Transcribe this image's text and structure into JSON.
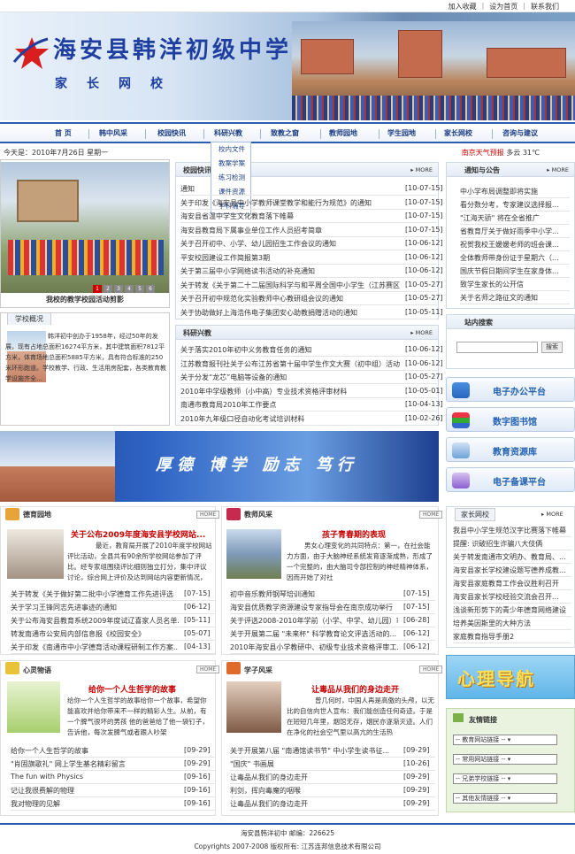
{
  "toplinks": [
    "加入收藏",
    "设为首页",
    "联系我们"
  ],
  "banner": {
    "school_name": "海安县韩洋初级中学",
    "subtitle": "家长网校"
  },
  "nav": [
    "首 页",
    "韩中风采",
    "校园快讯",
    "科研兴教",
    "致教之窗",
    "教师园地",
    "学生园地",
    "家长网校",
    "咨询与建议"
  ],
  "today": "今天是：2010年7月26日 星期一",
  "weather": {
    "label": "南京天气预报",
    "value": "多云 31℃"
  },
  "dropdown": [
    "校内文件",
    "教案学案",
    "练习检测",
    "课件资源",
    "学科辅导"
  ],
  "photo_caption": "我校的教学校园活动剪影",
  "slide_numbers": [
    "1",
    "2",
    "3",
    "4",
    "5",
    "6"
  ],
  "school_news": {
    "title": "校园快讯",
    "more": "MORE",
    "items": [
      {
        "text": "通知",
        "date": "[10-07-15]"
      },
      {
        "text": "关于印发《海安县中小学教师课堂教学和能行为规范》的通知",
        "date": "[10-07-15]"
      },
      {
        "text": "海安县省温中学生文化教育落下帷幕",
        "date": "[10-07-15]"
      },
      {
        "text": "海安县教育局下属事业单位工作人员招考简章",
        "date": "[10-07-15]"
      },
      {
        "text": "关于召开初中、小学、幼儿园招生工作会议的通知",
        "date": "[10-06-12]"
      },
      {
        "text": "平安校园建设工作简报第3期",
        "date": "[10-06-12]"
      },
      {
        "text": "关于第三届中小学网络读书活动的补充通知",
        "date": "[10-06-12]"
      },
      {
        "text": "关于转发《关于第二十二届国际科学与和平周全国中小学生（江苏赛区",
        "date": "[10-05-27]"
      },
      {
        "text": "关于召开初中规范化实验教师中心教研组会议的通知",
        "date": "[10-05-27]"
      },
      {
        "text": "关于协助做好上海浩伟电子集团安心助教捐赠活动的通知",
        "date": "[10-05-11]"
      }
    ]
  },
  "research": {
    "title": "科研兴教",
    "more": "MORE",
    "items": [
      {
        "text": "关于落实2010年初中义务教育任务的通知",
        "date": "[10-06-12]"
      },
      {
        "text": "江苏教育报刊社关于公布江苏省第十届中学生作文大赛（初中组）活动",
        "date": "[10-06-12]"
      },
      {
        "text": "关于分发“龙芯”电脑等设备的通知",
        "date": "[10-05-27]"
      },
      {
        "text": "2010年中学级教师（小中高）专业技术资格评审材料",
        "date": "[10-05-01]"
      },
      {
        "text": "南通市教育局2010年工作要点",
        "date": "[10-04-13]"
      },
      {
        "text": "2010年九年级口径自动化考试培训材料",
        "date": "[10-02-26]"
      }
    ]
  },
  "notices": {
    "title": "通知与公告",
    "more": "MORE",
    "items": [
      "中小学布局调整即将实施",
      "看分数分考，专家建议选择报...",
      "\"江海天骄\" 将在全省推广",
      "省教育厅关于做好雨季中小学...",
      "祝贺我校王媛媛老师的班会课...",
      "全体教师带身份证于星期六（...",
      "国庆节假日期间学生在家身体...",
      "致学生家长的公开信",
      "关于名师之路征文的通知"
    ]
  },
  "search": {
    "title": "站内搜索",
    "button": "搜索"
  },
  "school_intro": {
    "tab": "学校概况",
    "text": "韩洋初中创办于1958年，经过50年的发展，现有占地总面积16274平方米，其中建筑面积7812平方米，体育场地总面积5885平方米，具有符合标准的250米环形跑道。学校教学、行政、生活用房配套，各类教育教学设施齐全..."
  },
  "slogan": "厚德 博学 励志 笃行",
  "right_buttons": [
    {
      "label": "电子办公平台"
    },
    {
      "label": "数字图书馆"
    },
    {
      "label": "教育资源库"
    },
    {
      "label": "电子备课平台"
    }
  ],
  "moral": {
    "title": "德育园地",
    "home": "HOME",
    "headline": "关于公布2009年度海安县学校网站...",
    "para": "最近，教育局开展了2010年度学校网站评比活动，全县共有90余所学校网站参加了评比。经专家组围绕评比细则独立打分，集中评议讨论，综合网上评价及达到网站内容更新情况，",
    "items": [
      {
        "text": "关于转发《关于做好第二批中小学德育工作先进评选",
        "date": "[07-15]"
      },
      {
        "text": "关于学习王锋同志先进事迹的通知",
        "date": "[06-12]"
      },
      {
        "text": "关于公布海安县教育系统2009年度试辽喜家人员名单...",
        "date": "[05-11]"
      },
      {
        "text": "转发南通市公安局内部信息报《校园安全》",
        "date": "[05-07]"
      },
      {
        "text": "关于印发《南通市中小学德育活动课程研制工作方案...",
        "date": "[04-13]"
      }
    ]
  },
  "teacher": {
    "title": "教师风采",
    "home": "HOME",
    "headline": "孩子青春期的表现",
    "para": "男女心理变化的共同特点：第一，在社会能力方面，由于大脑神经系统发育逐渐成熟，形成了一个完整的，由大脑司令部控制的神经精神体系，因而开始了对社",
    "items": [
      {
        "text": "初中音乐教师钢琴培训通知",
        "date": "[07-15]"
      },
      {
        "text": "海安县优质教学资源建设专家指导会在南京成功举行",
        "date": "[07-15]"
      },
      {
        "text": "关于评选2008-2010年学前（小学、中学、幼儿园）市级师资...",
        "date": "[06-28]"
      },
      {
        "text": "关于开展第二届 \"未来杯\" 科学教育论文评选活动的...",
        "date": "[06-12]"
      },
      {
        "text": "2010年海安县小学教研中、初级专业技术资格评审工...",
        "date": "[06-12]"
      }
    ]
  },
  "parent": {
    "title": "家长网校",
    "more": "MORE",
    "items": [
      "我县中小学生规范汉字比赛落下帷幕",
      "提醒: 识破招生诈骗八大伎俩",
      "关于转发南通市文明办、教育局、...",
      "海安县家长学校建设题写德养成教...",
      "海安县家庭教育工作会议胜利召开",
      "海安县家长学校经验交流会召开...",
      "浅谈新形势下的青少年德育网络建设",
      "培养美因斯里的大种方法",
      "家庭教育指导手册2"
    ]
  },
  "heart": {
    "title": "心灵物语",
    "home": "HOME",
    "headline": "给你一个人生哲学的故事",
    "para": "给你一个人生哲学的故事给你一个故事，希望你能喜欢并给你带来不一样的精彩人生。从前，有一个脾气很坏的男孩 他的爸爸给了他一袋钉子，告诉他，每次发脾气或者跟人吵架",
    "items": [
      {
        "text": "给你一个人生哲学的故事",
        "date": "[09-29]"
      },
      {
        "text": "\"肖固旗歌礼\" 网上学生基名精彩留言",
        "date": "[09-29]"
      },
      {
        "text": "The fun with Physics",
        "date": "[09-16]"
      },
      {
        "text": "记让我很费解的物理",
        "date": "[09-16]"
      },
      {
        "text": "我对物理的见解",
        "date": "[09-16]"
      }
    ]
  },
  "student": {
    "title": "学子风采",
    "home": "HOME",
    "headline": "让毒品从我们的身边走开",
    "para": "曾几何时，中国人再是高傲的头颅，以无比的自信向世人宣布：我们能创造任何奇迹。于是在短短几年里，烟馆无存，烟民亦逐渐灭迹。人们在净化的社会空气里以高亢的生活热",
    "items": [
      {
        "text": "关于开展第八届 \"南通馆读书节\" 中小学生读书征...",
        "date": "[09-29]"
      },
      {
        "text": "\"国庆\" 书画展",
        "date": "[10-26]"
      },
      {
        "text": "让毒品从我们的身边走开",
        "date": "[09-29]"
      },
      {
        "text": "利剑，挥向毒魔的咽喉",
        "date": "[09-29]"
      },
      {
        "text": "让毒品从我们的身边走开",
        "date": "[09-29]"
      }
    ]
  },
  "psych": {
    "label": "心理导航"
  },
  "friend_links": {
    "title": "友情链接",
    "options": [
      "教育网站链接",
      "常用网站链接",
      "兄弟学校链接",
      "其他友情链接"
    ]
  },
  "footer": {
    "line1": "海安县韩洋初中    邮编：226625",
    "line2": "Copyrights 2007-2008 版权所有: 江苏连邦信息技术有限公司"
  },
  "colors": {
    "nav_border": "#2a5fb0",
    "headline_red": "#c60000",
    "brand_blue": "#1f3fa0"
  }
}
